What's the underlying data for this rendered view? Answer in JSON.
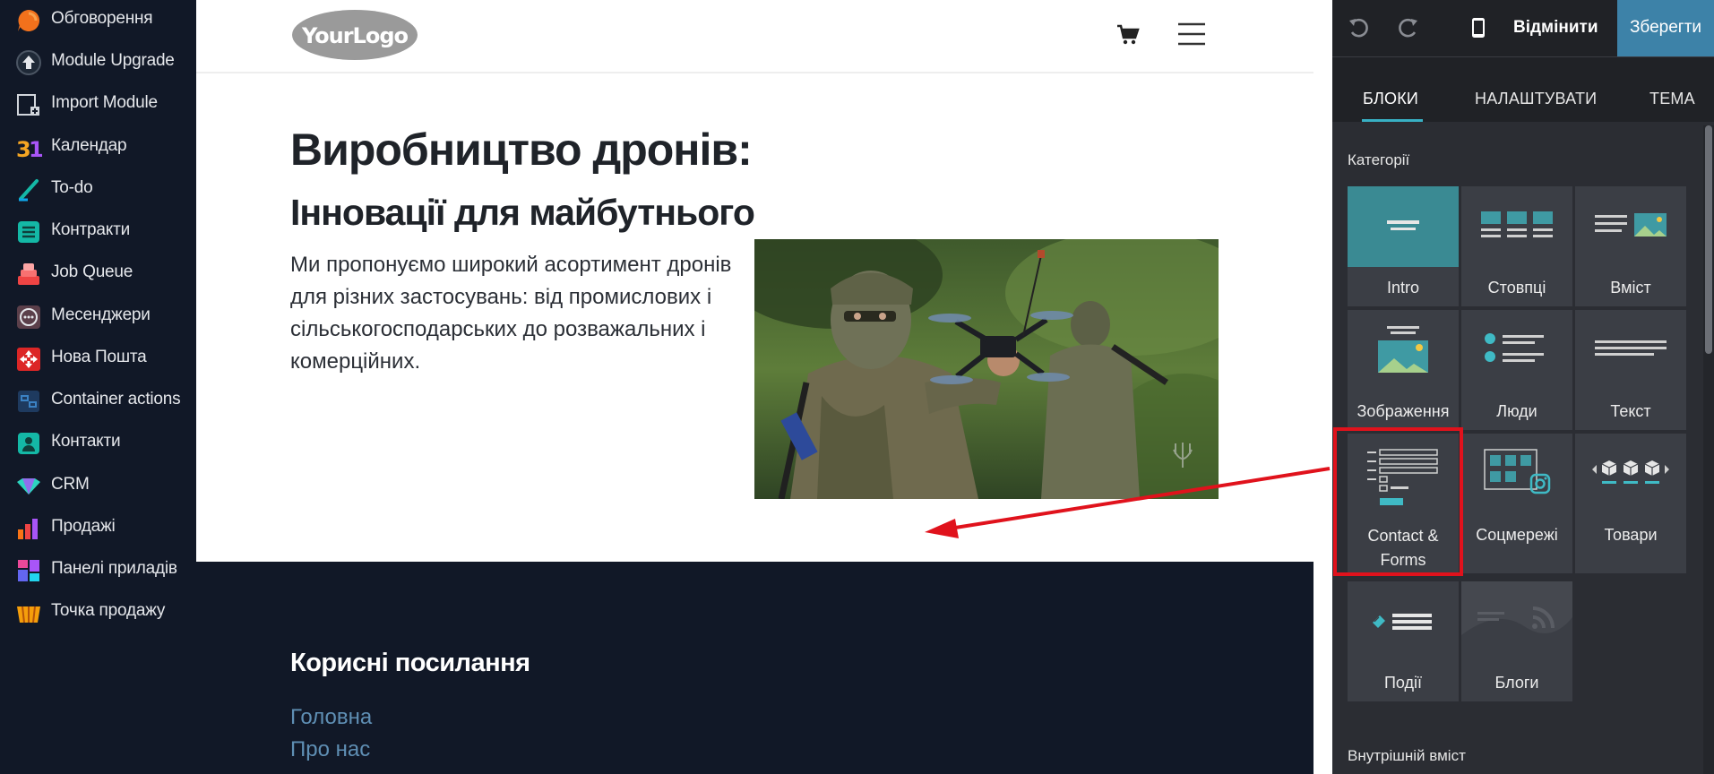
{
  "sidebar": {
    "items": [
      {
        "label": "Обговорення",
        "icon": "discuss-icon"
      },
      {
        "label": "Module Upgrade",
        "icon": "upgrade-icon"
      },
      {
        "label": "Import Module",
        "icon": "import-icon"
      },
      {
        "label": "Календар",
        "icon": "calendar-icon"
      },
      {
        "label": "To-do",
        "icon": "todo-icon"
      },
      {
        "label": "Контракти",
        "icon": "contracts-icon"
      },
      {
        "label": "Job Queue",
        "icon": "job-queue-icon"
      },
      {
        "label": "Месенджери",
        "icon": "messenger-icon"
      },
      {
        "label": "Нова Пошта",
        "icon": "nova-poshta-icon"
      },
      {
        "label": "Container actions",
        "icon": "container-icon"
      },
      {
        "label": "Контакти",
        "icon": "contacts-icon"
      },
      {
        "label": "CRM",
        "icon": "crm-icon"
      },
      {
        "label": "Продажі",
        "icon": "sales-icon"
      },
      {
        "label": "Панелі приладів",
        "icon": "dashboard-icon"
      },
      {
        "label": "Точка продажу",
        "icon": "pos-icon"
      }
    ]
  },
  "site": {
    "logo_text": "YourLogo",
    "hero_title": "Виробництво дронів:",
    "hero_subtitle": "Інновації для майбутнього",
    "hero_text": "Ми пропонуємо широкий асортимент дронів для різних застосувань: від промислових і сільськогосподарських до розважальних і комерційних.",
    "footer_title": "Корисні посилання",
    "footer_links": [
      "Головна",
      "Про нас"
    ]
  },
  "editor": {
    "discard_label": "Відмінити",
    "save_label": "Зберегти",
    "tabs": [
      "Блоки",
      "Налаштувати",
      "Тема"
    ],
    "categories_label": "Категорії",
    "snippets": [
      "Intro",
      "Стовпці",
      "Вміст",
      "Зображення",
      "Люди",
      "Текст",
      "Contact & Forms",
      "Соцмережі",
      "Товари",
      "Події",
      "Блоги"
    ],
    "inner_content_label": "Внутрішній вміст"
  },
  "colors": {
    "sidebar_bg": "#111827",
    "editor_bg": "#2b2d33",
    "save_button": "#3d82a8",
    "active_tab_underline": "#38b0c4",
    "highlight": "#e0121c",
    "footer_link": "#5f8fb4"
  }
}
